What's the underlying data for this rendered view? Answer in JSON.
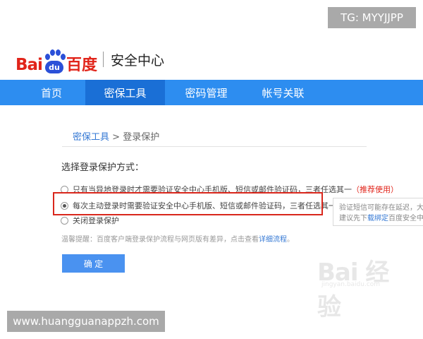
{
  "overlay": {
    "tg_label": "TG: MYYJJPP",
    "site_label": "www.huangguanappzh.com"
  },
  "brand": {
    "logo_latin": "Bai",
    "logo_paw_text": "du",
    "logo_cn": "百度",
    "title": "安全中心",
    "brand_color": "#e1241a",
    "paw_color": "#2b50d8"
  },
  "nav": {
    "items": [
      {
        "label": "首页"
      },
      {
        "label": "密保工具"
      },
      {
        "label": "密码管理"
      },
      {
        "label": "帐号关联"
      }
    ],
    "active_index": 1,
    "bar_color": "#2d8df0",
    "active_color": "#1a6fd6"
  },
  "breadcrumb": {
    "link": "密保工具",
    "separator": ">",
    "current": "登录保护"
  },
  "form": {
    "section_title": "选择登录保护方式：",
    "options": [
      {
        "text": "只有当异地登录时才需要验证安全中心手机版、短信或邮件验证码，三者任选其一",
        "suffix": "（推荐使用）",
        "checked": false
      },
      {
        "text": "每次主动登录时需要验证安全中心手机版、短信或邮件验证码，三者任选其一",
        "suffix": "",
        "checked": true
      },
      {
        "text": "关闭登录保护",
        "suffix": "",
        "checked": false
      }
    ],
    "tooltip_line1": "验证短信可能存在延迟，大",
    "tooltip_line2_pre": "建议先下",
    "tooltip_link": "载绑定",
    "tooltip_line2_post": "百度安全中",
    "tip_text": "温馨提醒：百度客户端登录保护流程与网页版有差异，点击查看",
    "tip_link": "详细流程",
    "tip_suffix": "。",
    "confirm_label": "确 定",
    "accent_color": "#d9271c"
  },
  "watermark": {
    "text": "Bai 经验",
    "sub": "jingyan.baidu.com"
  }
}
